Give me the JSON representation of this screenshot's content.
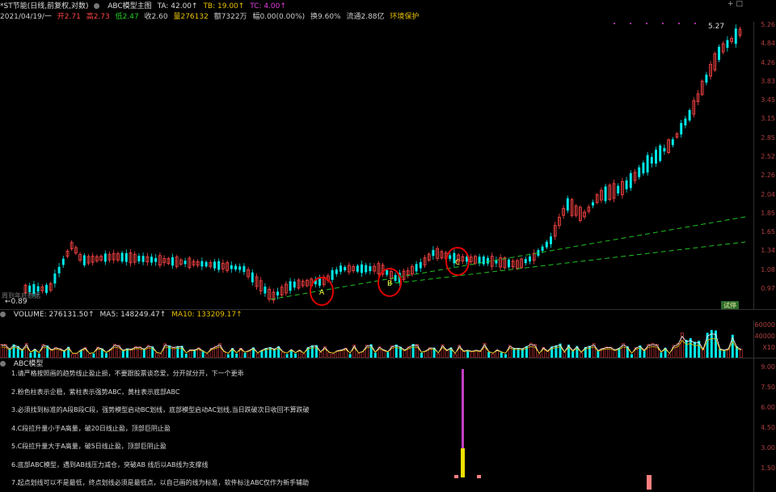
{
  "header": {
    "stock_name": "*ST节能(日线,前复权,对数)",
    "indicator_name": "ABC模型主图",
    "ta": "TA: 42.00↑",
    "tb": "TB: 19.00↑",
    "tc": "TC: 4.00↑",
    "controls": "+ □"
  },
  "quote": {
    "date": "2021/04/19/一",
    "open": "开2.71",
    "high": "高2.73",
    "low": "低2.47",
    "close": "收2.60",
    "volume": "量276132",
    "amount": "额7322万",
    "change": "幅0.00(0.00%)",
    "turnover": "换9.60%",
    "float_cap": "流通2.88亿",
    "env": "环境保护"
  },
  "main_chart": {
    "price_ticks": [
      "5.26",
      "4.84",
      "4.26",
      "3.83",
      "3.45",
      "3.15",
      "2.85",
      "2.52",
      "2.26",
      "2.04",
      "1.85",
      "1.65",
      "1.34",
      "1.08",
      "0.97"
    ],
    "high_label": "5.27",
    "low_label": "←0.89",
    "left_note": "周到年底数据",
    "badge": "试停",
    "markers": [
      "A",
      "B",
      "C"
    ],
    "colors": {
      "up": "#ff4545",
      "down": "#00e8e8",
      "support": "#22c022",
      "circle": "#e00000",
      "marker": "#ffff40"
    }
  },
  "volume": {
    "label": "VOLUME: 276131.50↑",
    "ma5": "MA5: 148249.47↑",
    "ma10": "MA10: 133209.17↑",
    "ticks": [
      "60000",
      "40000",
      "X10"
    ]
  },
  "abc": {
    "title": "ABC模型",
    "ticks": [
      "9.00",
      "7.50",
      "6.00",
      "4.50",
      "3.00",
      "1.50"
    ],
    "notes": [
      "1.请严格按照画的趋势线止盈止损，不要跟股票谈恋爱，分开就分开，下一个更乖",
      "2.粉色柱表示企稳，紫柱表示强势ABC，黄柱表示底部ABC",
      "3.必须找到标准的A段B段C段，强势模型启动BC划线，底部模型启动AC划线,当日跌破次日收回不算跌破",
      "4.C段拉升量小于A高量，破20日线止盈，顶部巨阴止盈",
      "5.C段拉升量大于A高量，破5日线止盈，顶部巨阴止盈",
      "6.底部ABC模型，遇到AB线压力减仓，突破AB 线后以AB线为支撑线",
      "7.起点划线可以不是最低，终点划线必须是最低点，以自己画的线为标准，软件标注ABC仅作为新手辅助"
    ]
  }
}
